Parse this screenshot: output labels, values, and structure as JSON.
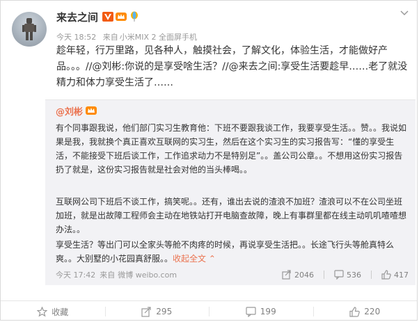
{
  "post": {
    "author": "来去之间",
    "time": "今天 18:52",
    "source_prefix": "来自",
    "source": "小米MIX 2 全面屏手机",
    "text": "趁年轻，行万里路，见各种人，触摸社会，了解文化，体验生活，才能做好产品。。。//@刘彬:你说的是享受啥生活？//@来去之间:享受生活要趁早……老了就没精力和体力享受生活了……"
  },
  "repost": {
    "author": "@刘彬",
    "paragraph1": "有个同事跟我说，他们部门实习生教育他：下班不要跟我谈工作，我要享受生活。。赞。。我说如果是我，我就换个真正喜欢互联网的实习生，然后在这个实习生的实习报告写：“懂的享受生活，不能接受下班后谈工作，工作追求动力不是特别足”。。盖公司公章。。不想用这份实习报告扔了就是，这份实习报告就是社会对他的当头棒喝。。",
    "paragraph2": "互联网公司下班后不谈工作，搞笑呢。。还有，谁出去说的渣浪不加班？渣浪可以不在公司坐班加班，就是出故障工程师会主动在地铁站打开电脑查故障，晚上有事群里都在线主动叽叽喳喳想办法。。",
    "paragraph3": "享受生活？等出门可以全家头等舱不肉疼的时候，再说享受生活把。。长途飞行头等舱真特么爽。。大别墅的小花园真舒服。。",
    "expand_label": "收起全文",
    "time": "今天 17:42",
    "source_prefix": "来自",
    "source": "微博 weibo.com",
    "stats": {
      "repost": "2046",
      "comment": "536",
      "like": "417"
    }
  },
  "actions": {
    "favorite": "收藏",
    "repost": "295",
    "comment": "199",
    "like": "220"
  },
  "colors": {
    "accent": "#eb7350",
    "repost_bg": "#f2f2f5",
    "muted": "#999999"
  },
  "icons": [
    "avatar-robot",
    "verified-v-icon",
    "crown-icon",
    "balloon-icon",
    "chevron-down-icon",
    "share-icon",
    "comment-icon",
    "like-icon",
    "star-icon"
  ]
}
